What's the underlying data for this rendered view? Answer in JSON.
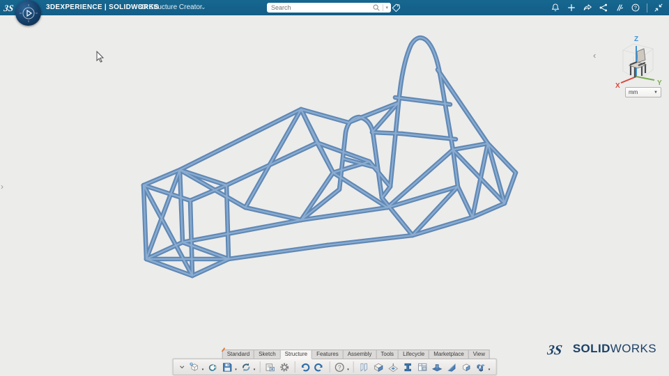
{
  "top_bar": {
    "brand": "3DEXPERIENCE | SOLIDWORKS",
    "app_name": "3D Structure Creator",
    "app_switcher_chevron": "⌄",
    "search_placeholder": "Search",
    "search_dropdown_chevron": "▾",
    "right_icons": [
      "notifications",
      "add",
      "share",
      "share-network",
      "collaboration",
      "help",
      "collapse"
    ]
  },
  "viewport": {
    "unit_selector": {
      "value": "mm",
      "chevron": "▼"
    },
    "axis_labels": {
      "x": "X",
      "y": "Y",
      "z": "Z"
    },
    "left_expand_chevron": "›",
    "right_collapse_chevron": "‹"
  },
  "model": {
    "name": "tubular-space-frame-chassis",
    "segments": [
      [
        206,
        266,
        273,
        288
      ],
      [
        273,
        288,
        276,
        396
      ],
      [
        276,
        396,
        210,
        372
      ],
      [
        210,
        372,
        206,
        266
      ],
      [
        258,
        244,
        325,
        266
      ],
      [
        325,
        266,
        328,
        372
      ],
      [
        328,
        372,
        262,
        348
      ],
      [
        262,
        348,
        258,
        244
      ],
      [
        206,
        266,
        258,
        244
      ],
      [
        273,
        288,
        325,
        266
      ],
      [
        276,
        396,
        328,
        372
      ],
      [
        210,
        372,
        262,
        348
      ],
      [
        206,
        266,
        276,
        396
      ],
      [
        210,
        372,
        328,
        372
      ],
      [
        210,
        372,
        258,
        244
      ],
      [
        258,
        244,
        432,
        157
      ],
      [
        432,
        157,
        500,
        176
      ],
      [
        325,
        266,
        455,
        205
      ],
      [
        455,
        205,
        530,
        232
      ],
      [
        262,
        348,
        432,
        316
      ],
      [
        432,
        316,
        556,
        298
      ],
      [
        328,
        372,
        470,
        352
      ],
      [
        470,
        352,
        592,
        338
      ],
      [
        592,
        338,
        678,
        312
      ],
      [
        258,
        244,
        352,
        298
      ],
      [
        352,
        298,
        432,
        157
      ],
      [
        352,
        298,
        432,
        316
      ],
      [
        432,
        157,
        455,
        205
      ],
      [
        432,
        157,
        478,
        248
      ],
      [
        478,
        248,
        432,
        316
      ],
      [
        478,
        248,
        530,
        232
      ],
      [
        478,
        248,
        556,
        298
      ],
      [
        455,
        205,
        478,
        248
      ],
      [
        500,
        176,
        571,
        148
      ],
      [
        530,
        232,
        560,
        268
      ],
      [
        493,
        228,
        541,
        241
      ],
      [
        534,
        190,
        577,
        192
      ],
      [
        548,
        284,
        592,
        338
      ],
      [
        487,
        272,
        432,
        316
      ],
      [
        548,
        284,
        560,
        268
      ],
      [
        571,
        148,
        534,
        190
      ],
      [
        567,
        140,
        646,
        150
      ],
      [
        577,
        192,
        654,
        200
      ],
      [
        628,
        100,
        700,
        206
      ],
      [
        700,
        206,
        740,
        248
      ],
      [
        740,
        248,
        724,
        292
      ],
      [
        724,
        292,
        678,
        312
      ],
      [
        650,
        215,
        700,
        206
      ],
      [
        650,
        215,
        724,
        292
      ],
      [
        700,
        206,
        724,
        292
      ],
      [
        700,
        206,
        678,
        312
      ],
      [
        657,
        268,
        678,
        312
      ],
      [
        556,
        298,
        650,
        215
      ],
      [
        556,
        298,
        657,
        268
      ],
      [
        592,
        338,
        657,
        268
      ]
    ],
    "curves": [
      "M487,272 L496,190 Q500,170 515,168 Q531,171 535,190 L548,284",
      "M560,268 L572,148 Q577,92 590,64 Q600,48 612,58 Q625,70 632,110 L650,215 L657,268"
    ]
  },
  "action_bar": {
    "tabs": [
      "Standard",
      "Sketch",
      "Structure",
      "Features",
      "Assembly",
      "Tools",
      "Lifecycle",
      "Marketplace",
      "View"
    ],
    "active_tab": "Structure",
    "buttons": [
      {
        "name": "toolbar-collapse",
        "chevron": true
      },
      {
        "name": "new",
        "dropdown": true
      },
      {
        "name": "open"
      },
      {
        "name": "save",
        "dropdown": true
      },
      {
        "name": "sync",
        "dropdown": true
      },
      {
        "type": "divider"
      },
      {
        "name": "import"
      },
      {
        "name": "settings"
      },
      {
        "type": "divider"
      },
      {
        "name": "undo"
      },
      {
        "name": "redo"
      },
      {
        "type": "divider"
      },
      {
        "name": "help",
        "dropdown": true
      },
      {
        "type": "divider"
      },
      {
        "name": "member"
      },
      {
        "name": "corner"
      },
      {
        "name": "pattern"
      },
      {
        "name": "profile-ibeam"
      },
      {
        "name": "cut-list-table"
      },
      {
        "name": "base-plate"
      },
      {
        "name": "gusset"
      },
      {
        "name": "trim-cube"
      },
      {
        "name": "structure-system",
        "dropdown": true
      }
    ]
  },
  "watermark": {
    "glyph": "3S",
    "bold": "SOLID",
    "light": "WORKS"
  },
  "colors": {
    "topbar_bg": "#135E88",
    "viewport_bg": "#ECECEB",
    "tube_dark": "#5F88B5",
    "tube_light": "#93B3D5",
    "axis_x": "#D5483C",
    "axis_y": "#78AD4F",
    "axis_z": "#3F93D2",
    "logo_navy": "#1D4166",
    "toolbar_bg": "#E3E1DF",
    "tab_bg": "#DBDAD8"
  }
}
